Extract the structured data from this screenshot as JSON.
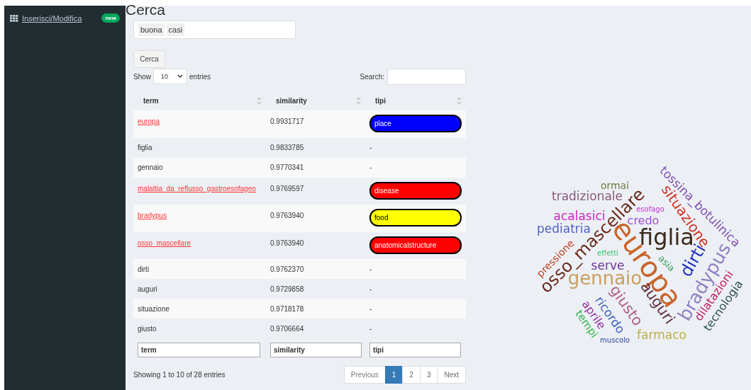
{
  "sidebar": {
    "items": [
      {
        "label": "Inserisci/Modifica",
        "badge": "new"
      }
    ]
  },
  "page_title": "Cerca",
  "query": {
    "tags": [
      "buona",
      "casi"
    ]
  },
  "search_button": "Cerca",
  "length": {
    "prefix": "Show",
    "value": "10",
    "suffix": "entries"
  },
  "filter": {
    "label": "Search:"
  },
  "table": {
    "columns": [
      "term",
      "similarity",
      "tipi"
    ],
    "rows": [
      {
        "term": "europa",
        "link": true,
        "similarity": "0.9931717",
        "tipi": {
          "kind": "badge",
          "label": "place",
          "color": "#0000ff"
        }
      },
      {
        "term": "figlia",
        "link": false,
        "similarity": "0.9833785",
        "tipi": {
          "kind": "text",
          "label": "-"
        }
      },
      {
        "term": "gennaio",
        "link": false,
        "similarity": "0.9770341",
        "tipi": {
          "kind": "text",
          "label": "-"
        }
      },
      {
        "term": "malattia_da_reflusso_gastroesofageo",
        "link": true,
        "similarity": "0.9769597",
        "tipi": {
          "kind": "badge",
          "label": "disease",
          "color": "#ff0000"
        }
      },
      {
        "term": "bradypus",
        "link": true,
        "similarity": "0.9763940",
        "tipi": {
          "kind": "badge",
          "label": "food",
          "color": "#ffff00"
        }
      },
      {
        "term": "osso_mascellare",
        "link": true,
        "similarity": "0.9763940",
        "tipi": {
          "kind": "badge",
          "label": "anatomicalstructure",
          "color": "#ff0000"
        }
      },
      {
        "term": "dirti",
        "link": false,
        "similarity": "0.9762370",
        "tipi": {
          "kind": "text",
          "label": "-"
        }
      },
      {
        "term": "auguri",
        "link": false,
        "similarity": "0.9729858",
        "tipi": {
          "kind": "text",
          "label": "-"
        }
      },
      {
        "term": "situazione",
        "link": false,
        "similarity": "0.9718178",
        "tipi": {
          "kind": "text",
          "label": "-"
        }
      },
      {
        "term": "giusto",
        "link": false,
        "similarity": "0.9706664",
        "tipi": {
          "kind": "text",
          "label": "-"
        }
      }
    ],
    "column_filters": [
      {
        "placeholder": "term"
      },
      {
        "placeholder": "similarity"
      },
      {
        "placeholder": "tipi"
      }
    ]
  },
  "info": "Showing 1 to 10 of 28 entries",
  "pagination": [
    {
      "label": "Previous",
      "selected": false,
      "disabled": true
    },
    {
      "label": "1",
      "selected": true,
      "disabled": false
    },
    {
      "label": "2",
      "selected": false,
      "disabled": false
    },
    {
      "label": "3",
      "selected": false,
      "disabled": false
    },
    {
      "label": "Next",
      "selected": false,
      "disabled": false
    }
  ],
  "word_cloud": {
    "words": [
      {
        "text": "tossina_botulinica",
        "color": "#8050b0"
      },
      {
        "text": "ormai",
        "color": "#6a7a40"
      },
      {
        "text": "tradizionale",
        "color": "#8a5a7a"
      },
      {
        "text": "situazione",
        "color": "#d03020"
      },
      {
        "text": "osso_mascellare",
        "color": "#6b2a1a"
      },
      {
        "text": "esofago",
        "color": "#c030d0"
      },
      {
        "text": "acalasici",
        "color": "#d020c0"
      },
      {
        "text": "credo",
        "color": "#a050d0"
      },
      {
        "text": "europa",
        "color": "#c8642a"
      },
      {
        "text": "pediatria",
        "color": "#5060c0"
      },
      {
        "text": "figlia",
        "color": "#3b2a1a"
      },
      {
        "text": "effetti",
        "color": "#40c070"
      },
      {
        "text": "pressione",
        "color": "#c04020"
      },
      {
        "text": "dirti",
        "color": "#2030c0"
      },
      {
        "text": "asia",
        "color": "#40a060"
      },
      {
        "text": "serve",
        "color": "#7030a0"
      },
      {
        "text": "bradypus",
        "color": "#9080c0"
      },
      {
        "text": "gennaio",
        "color": "#c8a060"
      },
      {
        "text": "dilatazioni",
        "color": "#c02060"
      },
      {
        "text": "auguri",
        "color": "#603040"
      },
      {
        "text": "giusto",
        "color": "#b06080"
      },
      {
        "text": "tecnologia",
        "color": "#305050"
      },
      {
        "text": "ricordo",
        "color": "#4060c0"
      },
      {
        "text": "aprile",
        "color": "#9030a0"
      },
      {
        "text": "tempi",
        "color": "#30b040"
      },
      {
        "text": "farmaco",
        "color": "#c0b040"
      },
      {
        "text": "muscolo",
        "color": "#3040a0"
      }
    ]
  }
}
